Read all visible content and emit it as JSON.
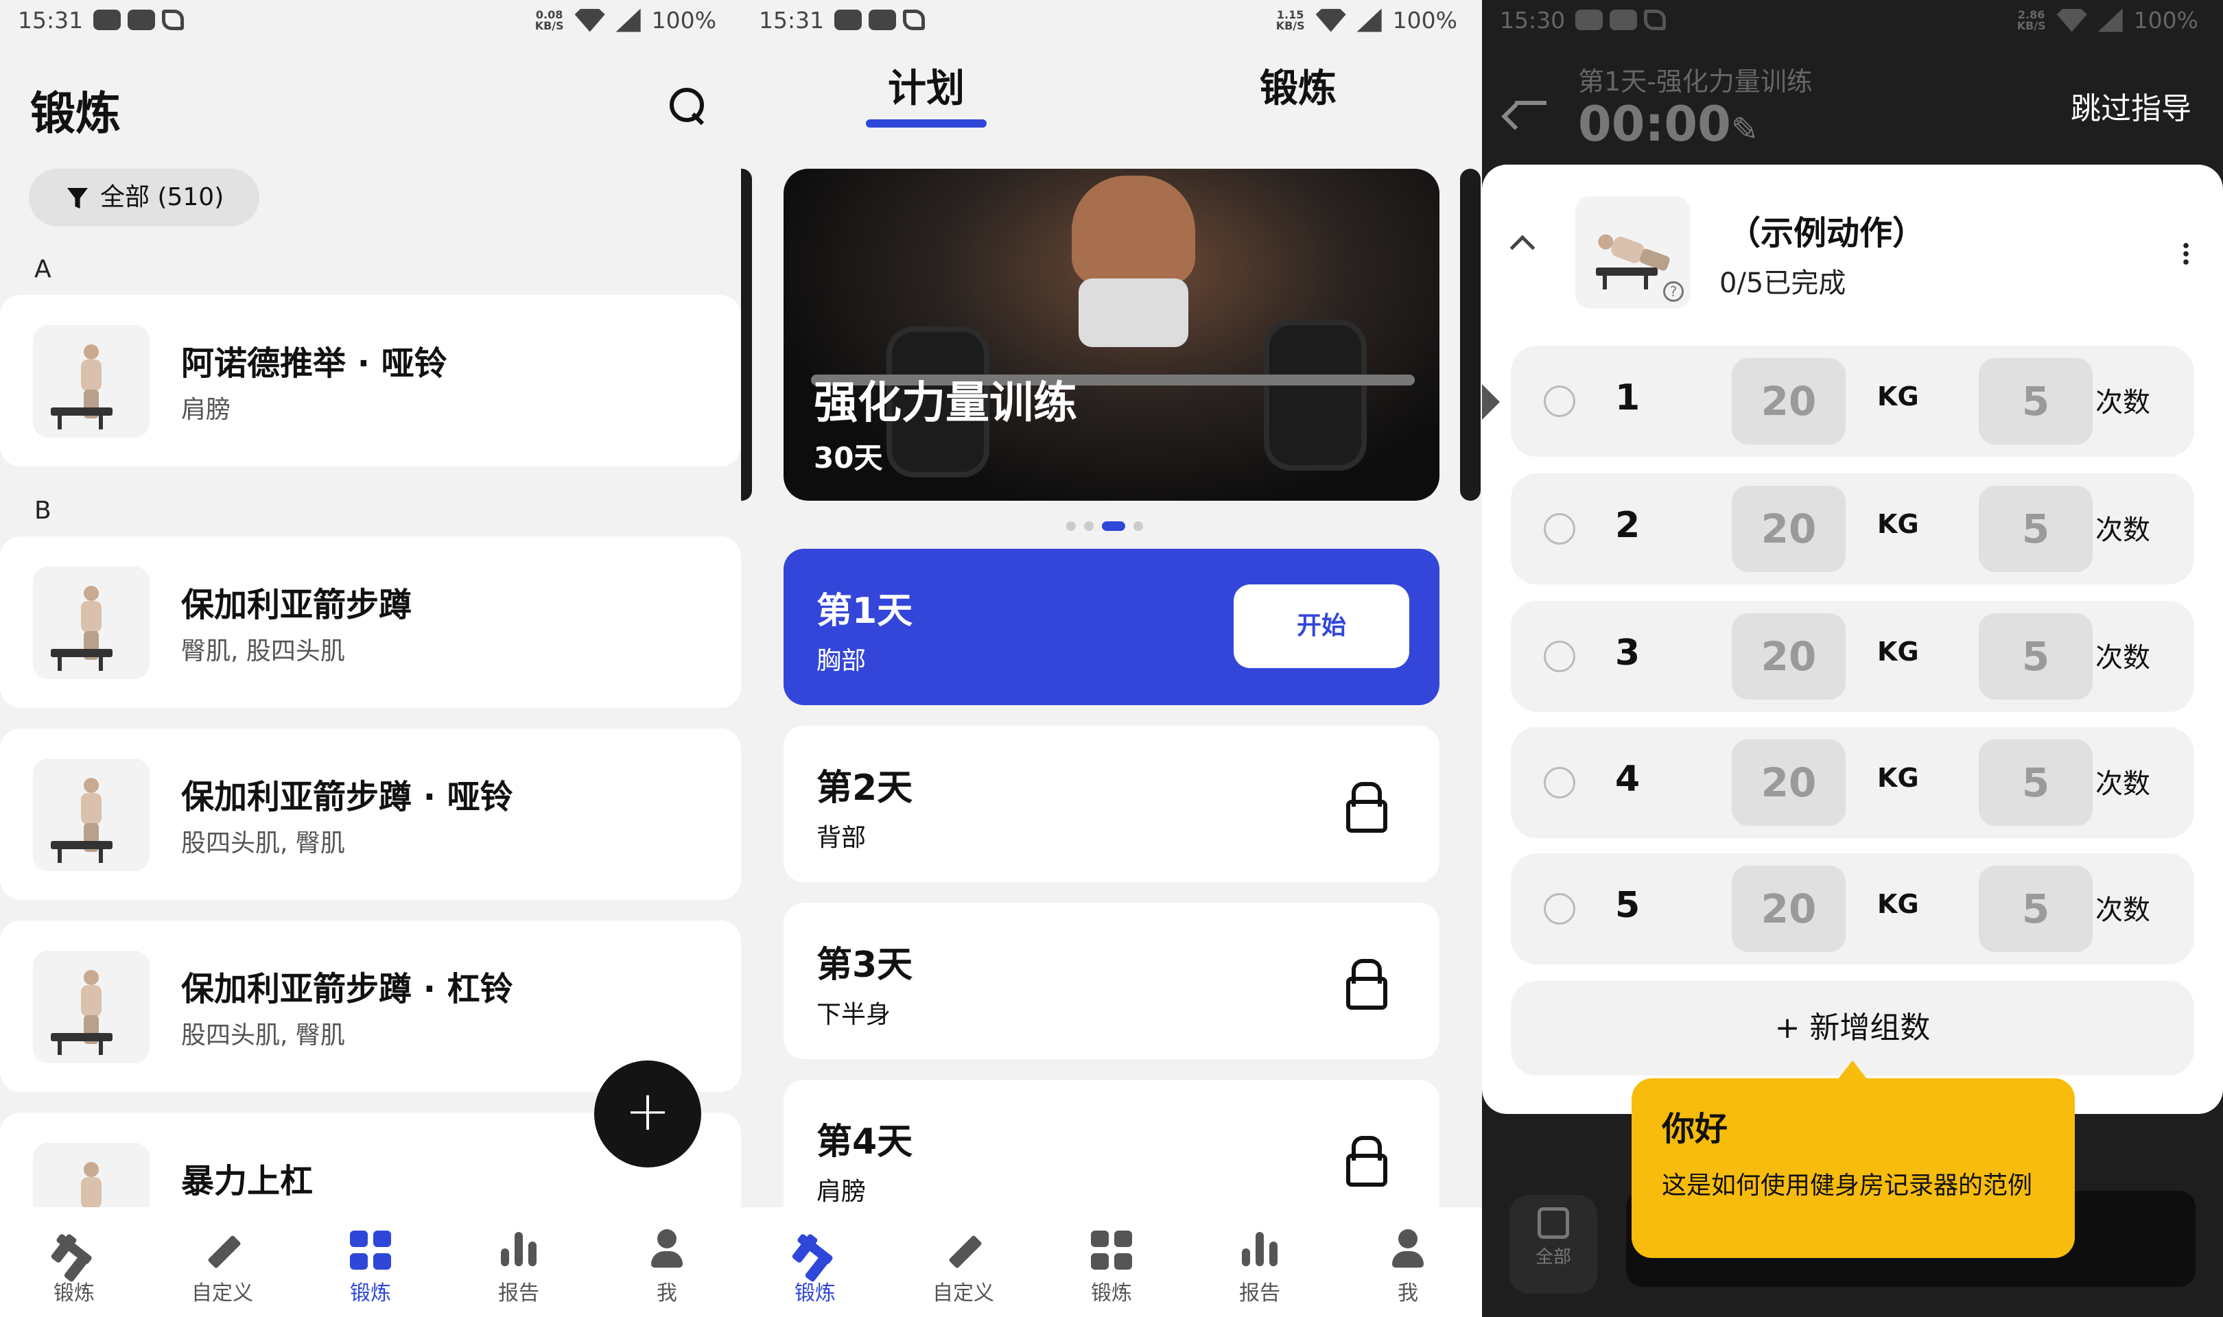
{
  "status": {
    "time1": "15:31",
    "time2": "15:31",
    "time3": "15:30",
    "kbs1": "0.08",
    "kbs2": "1.15",
    "kbs3": "2.86",
    "kbs_unit": "KB/S",
    "battery": "100%"
  },
  "p1": {
    "title": "锻炼",
    "filter": "全部 (510)",
    "sections": [
      {
        "letter": "A"
      },
      {
        "letter": "B"
      }
    ],
    "exercises": [
      {
        "name": "阿诺德推举 · 哑铃",
        "muscles": "肩膀"
      },
      {
        "name": "保加利亚箭步蹲",
        "muscles": "臀肌, 股四头肌"
      },
      {
        "name": "保加利亚箭步蹲 · 哑铃",
        "muscles": "股四头肌, 臀肌"
      },
      {
        "name": "保加利亚箭步蹲 · 杠铃",
        "muscles": "股四头肌, 臀肌"
      },
      {
        "name": "暴力上杠",
        "muscles": ""
      }
    ],
    "fab": "+"
  },
  "nav": [
    {
      "label": "锻炼",
      "icon": "dumbbell-icon"
    },
    {
      "label": "自定义",
      "icon": "pencil-icon"
    },
    {
      "label": "锻炼",
      "icon": "grid-icon"
    },
    {
      "label": "报告",
      "icon": "bar-chart-icon"
    },
    {
      "label": "我",
      "icon": "person-icon"
    }
  ],
  "p2": {
    "tabs": [
      "计划",
      "锻炼"
    ],
    "hero": {
      "title": "强化力量训练",
      "duration": "30天"
    },
    "days": [
      {
        "title": "第1天",
        "focus": "胸部",
        "action": "开始"
      },
      {
        "title": "第2天",
        "focus": "背部"
      },
      {
        "title": "第3天",
        "focus": "下半身"
      },
      {
        "title": "第4天",
        "focus": "肩膀"
      }
    ]
  },
  "p3": {
    "subtitle": "第1天-强化力量训练",
    "timer": "00:00",
    "skip": "跳过指导",
    "exercise": {
      "name": "（示例动作）",
      "progress": "0/5已完成"
    },
    "sets": [
      {
        "n": "1",
        "weight": "20",
        "unit": "KG",
        "reps": "5",
        "reps_label": "次数"
      },
      {
        "n": "2",
        "weight": "20",
        "unit": "KG",
        "reps": "5",
        "reps_label": "次数"
      },
      {
        "n": "3",
        "weight": "20",
        "unit": "KG",
        "reps": "5",
        "reps_label": "次数"
      },
      {
        "n": "4",
        "weight": "20",
        "unit": "KG",
        "reps": "5",
        "reps_label": "次数"
      },
      {
        "n": "5",
        "weight": "20",
        "unit": "KG",
        "reps": "5",
        "reps_label": "次数"
      }
    ],
    "add_set": "+ 新增组数",
    "all_label": "全部",
    "tooltip": {
      "title": "你好",
      "body": "这是如何使用健身房记录器的范例"
    }
  },
  "colors": {
    "accent": "#3346d9",
    "tooltip": "#f7bc0c",
    "dark_bg": "#1e1e1e"
  }
}
